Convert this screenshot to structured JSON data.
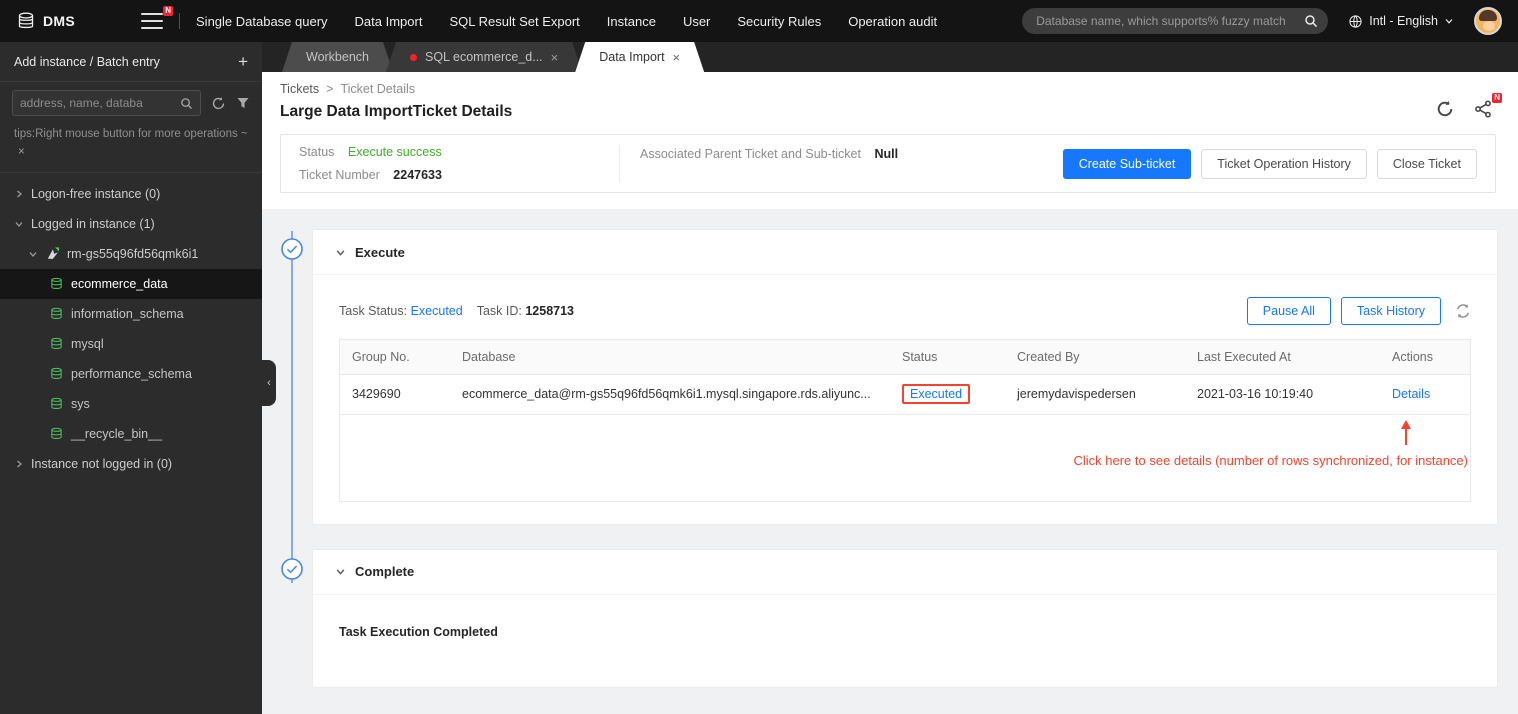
{
  "topbar": {
    "brand": "DMS",
    "menu_badge": "N",
    "nav": [
      "Single Database query",
      "Data Import",
      "SQL Result Set Export",
      "Instance",
      "User",
      "Security Rules",
      "Operation audit"
    ],
    "search_placeholder": "Database name, which supports% fuzzy match",
    "locale_label": "Intl - English"
  },
  "sidebar": {
    "add_entry_label": "Add instance / Batch entry",
    "search_placeholder": "address, name, databa",
    "tips_text": "tips:Right mouse button for more operations ~",
    "groups": {
      "logon_free": "Logon-free instance  (0)",
      "logged_in": "Logged in instance  (1)",
      "not_logged_in": "Instance not logged in  (0)"
    },
    "instance_name": "rm-gs55q96fd56qmk6i1",
    "databases": [
      "ecommerce_data",
      "information_schema",
      "mysql",
      "performance_schema",
      "sys",
      "__recycle_bin__"
    ],
    "selected_database": "ecommerce_data"
  },
  "tabs": {
    "workbench": "Workbench",
    "sql": "SQL ecommerce_d...",
    "data_import": "Data Import"
  },
  "page": {
    "breadcrumb": {
      "root": "Tickets",
      "separator": ">",
      "current": "Ticket Details"
    },
    "title": "Large Data ImportTicket Details",
    "share_badge": "N",
    "summary": {
      "status_label": "Status",
      "status_value": "Execute success",
      "ticket_label": "Ticket Number",
      "ticket_value": "2247633",
      "assoc_label": "Associated Parent Ticket and Sub-ticket",
      "assoc_value": "Null",
      "buttons": [
        "Create Sub-ticket",
        "Ticket Operation History",
        "Close Ticket"
      ]
    },
    "execute": {
      "title": "Execute",
      "task_status_label": "Task Status:",
      "task_status_value": "Executed",
      "task_id_label": "Task ID:",
      "task_id_value": "1258713",
      "pause_all": "Pause All",
      "task_history": "Task History",
      "table": {
        "headers": [
          "Group No.",
          "Database",
          "Status",
          "Created By",
          "Last Executed At",
          "Actions"
        ],
        "rows": [
          [
            "3429690",
            "ecommerce_data@rm-gs55q96fd56qmk6i1.mysql.singapore.rds.aliyunc...",
            "Executed",
            "jeremydavispedersen",
            "2021-03-16 10:19:40",
            "Details"
          ]
        ]
      },
      "annotation": "Click here to see details (number of rows synchronized, for instance)"
    },
    "complete": {
      "title": "Complete",
      "body": "Task Execution Completed"
    }
  },
  "icons": {
    "close": "×",
    "plus": "+",
    "collapse": "‹"
  },
  "colors": {
    "accent_blue": "#1677ff",
    "success_green": "#3fae29",
    "annotation_red": "#f5432d",
    "timeline_blue": "#85abe9"
  }
}
